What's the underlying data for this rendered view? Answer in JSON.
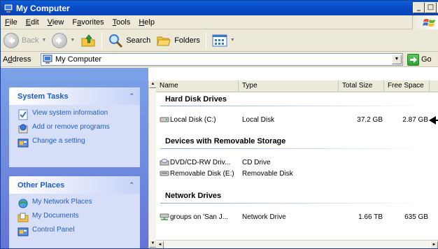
{
  "window": {
    "title": "My Computer",
    "controls": {
      "minimize": "_",
      "maximize": "□",
      "close": "x"
    }
  },
  "menu": [
    {
      "label": "File",
      "accel": "F",
      "rest": "ile"
    },
    {
      "label": "Edit",
      "accel": "E",
      "rest": "dit"
    },
    {
      "label": "View",
      "accel": "V",
      "rest": "iew"
    },
    {
      "label": "Favorites",
      "pre": "F",
      "accel": "a",
      "rest": "vorites"
    },
    {
      "label": "Tools",
      "accel": "T",
      "rest": "ools"
    },
    {
      "label": "Help",
      "accel": "H",
      "rest": "elp"
    }
  ],
  "toolbar": {
    "back_label": "Back",
    "search_label": "Search",
    "folders_label": "Folders"
  },
  "address": {
    "label_pre": "A",
    "label_accel": "d",
    "label_rest": "dress",
    "value": "My Computer",
    "go_label": "Go"
  },
  "tasks": {
    "system": {
      "title": "System Tasks",
      "collapse": "⌃",
      "items": [
        {
          "label": "View system information",
          "icon": "system-info-icon"
        },
        {
          "label": "Add or remove programs",
          "icon": "add-remove-programs-icon"
        },
        {
          "label": "Change a setting",
          "icon": "control-panel-icon"
        }
      ]
    },
    "places": {
      "title": "Other Places",
      "collapse": "⌃",
      "items": [
        {
          "label": "My Network Places",
          "icon": "network-places-icon"
        },
        {
          "label": "My Documents",
          "icon": "my-documents-icon"
        },
        {
          "label": "Control Panel",
          "icon": "control-panel-icon"
        }
      ]
    }
  },
  "columns": [
    "Name",
    "Type",
    "Total Size",
    "Free Space"
  ],
  "groups": {
    "hdd": "Hard Disk Drives",
    "removable": "Devices with Removable Storage",
    "network": "Network Drives"
  },
  "rows": {
    "local_c": {
      "name": "Local Disk (C:)",
      "type": "Local Disk",
      "total": "37.2 GB",
      "free": "2.87 GB"
    },
    "dvd": {
      "name": "DVD/CD-RW Driv...",
      "type": "CD Drive"
    },
    "removable_e": {
      "name": "Removable Disk (E:)",
      "type": "Removable Disk"
    },
    "network_drive": {
      "name": "groups on 'San J...",
      "type": "Network Drive",
      "total": "1.66 TB",
      "free": "635 GB"
    }
  },
  "colors": {
    "title_bar": "#0a4fc8",
    "task_link": "#215dc6",
    "task_pane_bg": "#7ba2e7"
  }
}
